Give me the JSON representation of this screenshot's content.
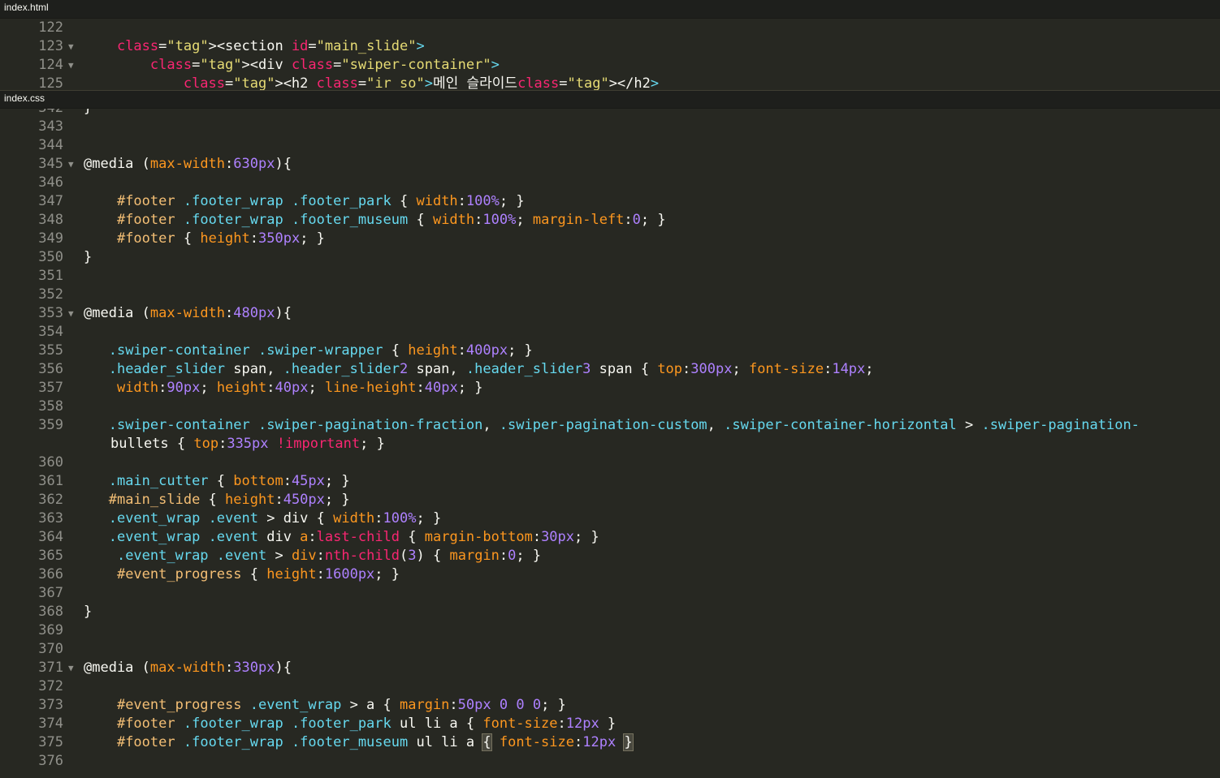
{
  "tabs": {
    "html": "index.html",
    "css": "index.css"
  },
  "html_lines": [
    {
      "n": "122",
      "fold": "",
      "code": ""
    },
    {
      "n": "123",
      "fold": "▼",
      "code": "    <section id=\"main_slide\">"
    },
    {
      "n": "124",
      "fold": "▼",
      "code": "        <div class=\"swiper-container\">"
    },
    {
      "n": "125",
      "fold": "",
      "code": "            <h2 class=\"ir_so\">메인 슬라이드</h2>"
    }
  ],
  "css_lines": [
    {
      "n": "342",
      "fold": "",
      "code": "}"
    },
    {
      "n": "343",
      "fold": "",
      "code": ""
    },
    {
      "n": "344",
      "fold": "",
      "code": ""
    },
    {
      "n": "345",
      "fold": "▼",
      "code": "@media (max-width:630px){"
    },
    {
      "n": "346",
      "fold": "",
      "code": ""
    },
    {
      "n": "347",
      "fold": "",
      "code": "    #footer .footer_wrap .footer_park { width:100%; }"
    },
    {
      "n": "348",
      "fold": "",
      "code": "    #footer .footer_wrap .footer_museum { width:100%; margin-left:0; }"
    },
    {
      "n": "349",
      "fold": "",
      "code": "    #footer { height:350px; }"
    },
    {
      "n": "350",
      "fold": "",
      "code": "}"
    },
    {
      "n": "351",
      "fold": "",
      "code": ""
    },
    {
      "n": "352",
      "fold": "",
      "code": ""
    },
    {
      "n": "353",
      "fold": "▼",
      "code": "@media (max-width:480px){"
    },
    {
      "n": "354",
      "fold": "",
      "code": ""
    },
    {
      "n": "355",
      "fold": "",
      "code": "   .swiper-container .swiper-wrapper { height:400px; }"
    },
    {
      "n": "356",
      "fold": "",
      "code": "   .header_slider span, .header_slider2 span, .header_slider3 span { top:300px; font-size:14px;"
    },
    {
      "n": "357",
      "fold": "",
      "code": "    width:90px; height:40px; line-height:40px; }"
    },
    {
      "n": "358",
      "fold": "",
      "code": ""
    },
    {
      "n": "359",
      "fold": "",
      "code": "   .swiper-container .swiper-pagination-fraction, .swiper-pagination-custom, .swiper-container-horizontal > .swiper-pagination-"
    },
    {
      "n": "",
      "fold": "",
      "code": "bullets { top:335px !important; }",
      "wrap": true
    },
    {
      "n": "360",
      "fold": "",
      "code": ""
    },
    {
      "n": "361",
      "fold": "",
      "code": "   .main_cutter { bottom:45px; }"
    },
    {
      "n": "362",
      "fold": "",
      "code": "   #main_slide { height:450px; }"
    },
    {
      "n": "363",
      "fold": "",
      "code": "   .event_wrap .event > div { width:100%; }"
    },
    {
      "n": "364",
      "fold": "",
      "code": "   .event_wrap .event div a:last-child { margin-bottom:30px; }"
    },
    {
      "n": "365",
      "fold": "",
      "code": "    .event_wrap .event > div:nth-child(3) { margin:0; }"
    },
    {
      "n": "366",
      "fold": "",
      "code": "    #event_progress { height:1600px; }"
    },
    {
      "n": "367",
      "fold": "",
      "code": ""
    },
    {
      "n": "368",
      "fold": "",
      "code": "}"
    },
    {
      "n": "369",
      "fold": "",
      "code": ""
    },
    {
      "n": "370",
      "fold": "",
      "code": ""
    },
    {
      "n": "371",
      "fold": "▼",
      "code": "@media (max-width:330px){"
    },
    {
      "n": "372",
      "fold": "",
      "code": ""
    },
    {
      "n": "373",
      "fold": "",
      "code": "    #event_progress .event_wrap > a { margin:50px 0 0 0; }"
    },
    {
      "n": "374",
      "fold": "",
      "code": "    #footer .footer_wrap .footer_park ul li a { font-size:12px }"
    },
    {
      "n": "375",
      "fold": "",
      "code": "    #footer .footer_wrap .footer_museum ul li a { font-size:12px }",
      "cursor": true
    },
    {
      "n": "376",
      "fold": "",
      "code": ""
    }
  ]
}
